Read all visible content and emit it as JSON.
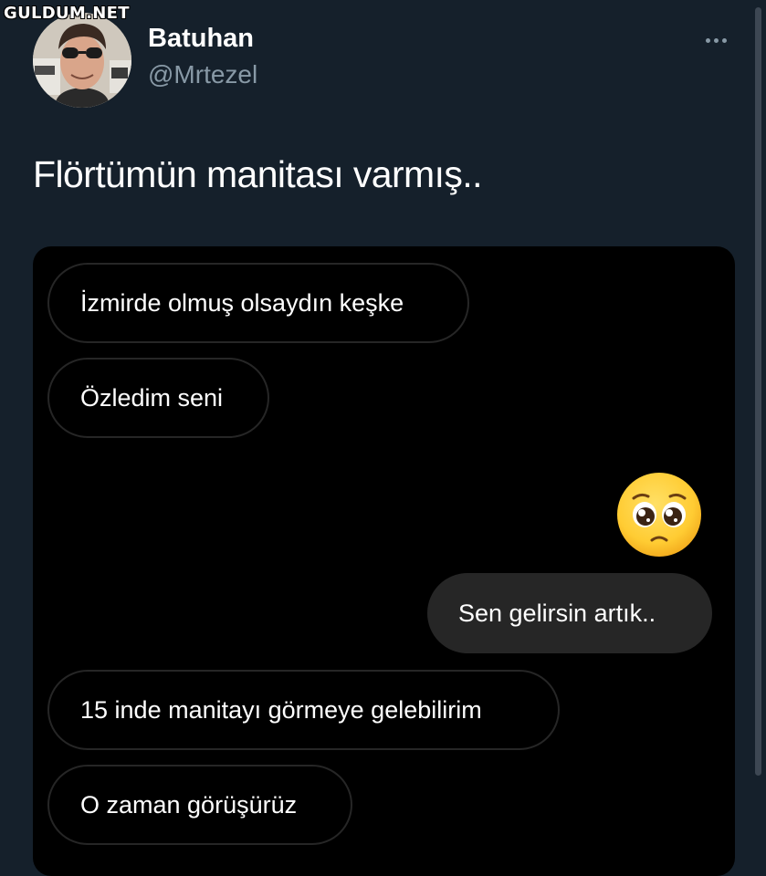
{
  "watermark": "GULDUM.NET",
  "tweet": {
    "display_name": "Batuhan",
    "handle": "@Mrtezel",
    "more_icon": "more-horizontal-icon",
    "text": "Flörtümün manitası varmış.."
  },
  "chat": {
    "messages": [
      {
        "direction": "incoming",
        "text": "İzmirde olmuş olsaydın keşke"
      },
      {
        "direction": "incoming",
        "text": "Özledim seni"
      },
      {
        "direction": "outgoing",
        "emoji": "pleading-face-emoji"
      },
      {
        "direction": "outgoing",
        "text": "Sen gelirsin artık.."
      },
      {
        "direction": "incoming",
        "text": "15 inde manitayı görmeye gelebilirim"
      },
      {
        "direction": "incoming",
        "text": "O zaman görüşürüz"
      }
    ]
  },
  "colors": {
    "background": "#15202b",
    "media_background": "#000000",
    "secondary_text": "#8899a6",
    "bubble_outgoing": "#262626",
    "bubble_border": "#262626"
  }
}
